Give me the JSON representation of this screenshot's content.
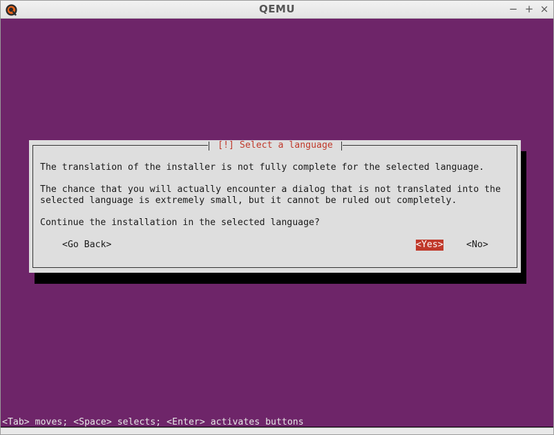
{
  "window": {
    "title": "QEMU",
    "controls": {
      "minimize": "−",
      "maximize": "+",
      "close": "×"
    },
    "app_icon": "qemu-logo-icon"
  },
  "dialog": {
    "title": "[!] Select a language",
    "lines": [
      "The translation of the installer is not fully complete for the selected language.",
      "The chance that you will actually encounter a dialog that is not translated into the",
      "selected language is extremely small, but it cannot be ruled out completely.",
      "Continue the installation in the selected language?"
    ],
    "buttons": {
      "go_back": "<Go Back>",
      "yes": "<Yes>",
      "no": "<No>"
    },
    "selected_button": "yes"
  },
  "status_bar": {
    "text": "<Tab> moves; <Space> selects; <Enter> activates buttons"
  },
  "colors": {
    "background": "#6e2569",
    "dialog_bg": "#dedede",
    "accent_red": "#c0392b"
  }
}
